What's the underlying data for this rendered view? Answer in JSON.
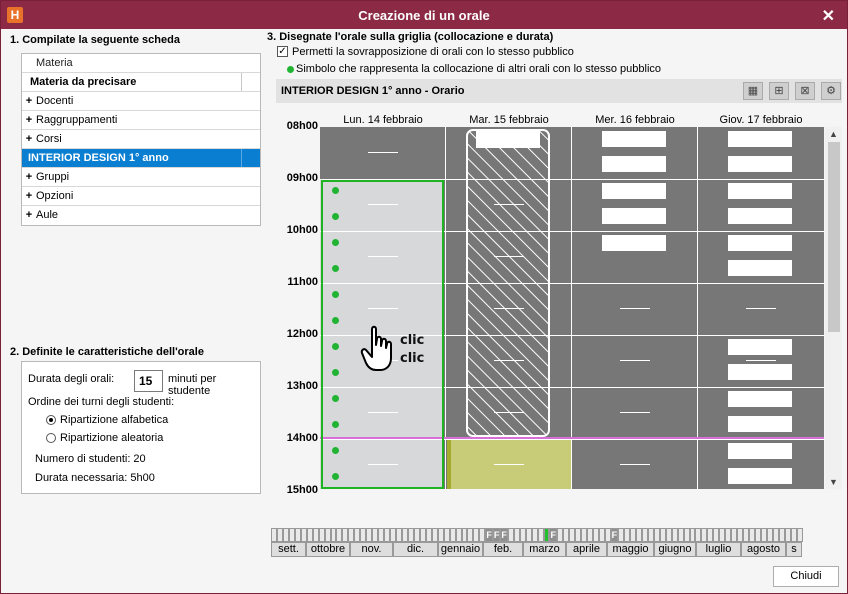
{
  "window": {
    "title": "Creazione di un orale",
    "app_icon": "H"
  },
  "section1": {
    "title": "1. Compilate la seguente scheda",
    "header": "Materia",
    "subject": "Materia da precisare",
    "rows": [
      {
        "label": "Docenti",
        "expandable": true
      },
      {
        "label": "Raggruppamenti",
        "expandable": true
      },
      {
        "label": "Corsi",
        "expandable": true
      },
      {
        "label": "INTERIOR DESIGN  1° anno",
        "selected": true
      },
      {
        "label": "Gruppi",
        "expandable": true
      },
      {
        "label": "Opzioni",
        "expandable": true
      },
      {
        "label": "Aule",
        "expandable": true
      }
    ],
    "plus_symbol": "+"
  },
  "section2": {
    "title": "2. Definite le caratteristiche dell'orale",
    "duration_label": "Durata degli orali:",
    "duration_value": "15",
    "duration_unit": "minuti per studente",
    "order_label": "Ordine dei turni degli studenti:",
    "option_alpha": "Ripartizione alfabetica",
    "option_random": "Ripartizione aleatoria",
    "students": "Numero di studenti: 20",
    "needed": "Durata necessaria: 5h00"
  },
  "section3": {
    "title": "3. Disegnate l'orale sulla griglia (collocazione e durata)",
    "overlap_label": "Permetti la sovrapposizione di orali con lo stesso pubblico",
    "overlap_checked": true,
    "symbol_label": "Simbolo che rappresenta la collocazione di altri orali con lo stesso pubblico",
    "grid_title": "INTERIOR DESIGN  1° anno - Orario",
    "days": [
      "Lun. 14 febbraio",
      "Mar. 15 febbraio",
      "Mer. 16 febbraio",
      "Giov. 17 febbraio"
    ],
    "hours": [
      "08h00",
      "09h00",
      "10h00",
      "11h00",
      "12h00",
      "13h00",
      "14h00",
      "15h00"
    ],
    "clic_text": [
      "clic",
      "clic"
    ]
  },
  "timeline": {
    "months": [
      "sett.",
      "ottobre",
      "nov.",
      "dic.",
      "gennaio",
      "feb.",
      "marzo",
      "aprile",
      "maggio",
      "giugno",
      "luglio",
      "agosto",
      "s"
    ],
    "holiday_mark": "F"
  },
  "buttons": {
    "close": "Chiudi"
  },
  "colors": {
    "titlebar": "#8c2a45",
    "selected": "#0a7fd2",
    "grid": "#777777",
    "placement": "#21b332",
    "busy": "#c8cc78"
  }
}
